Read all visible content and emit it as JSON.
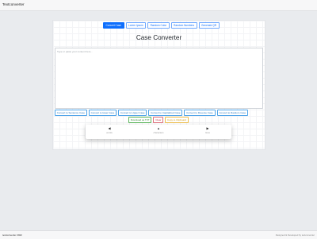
{
  "app": {
    "brand": "Textconverter"
  },
  "tabs": [
    {
      "label": "Convert Case",
      "active": true
    },
    {
      "label": "Lorem Ipsum"
    },
    {
      "label": "Random Color"
    },
    {
      "label": "Random Numbers"
    },
    {
      "label": "Generate QR"
    }
  ],
  "main": {
    "title": "Case Converter",
    "editor_placeholder": "Type or paste your content here..."
  },
  "convert_buttons": [
    "Convert to Sentence Case",
    "Convert to lower Case",
    "Convert to Upper Case",
    "Convert to Capitalized Case",
    "Convert to Reverse Case",
    "Convert to Random Case"
  ],
  "action_buttons": {
    "download": "Download as TXT",
    "clear": "Clear",
    "copy": "Copy to Clipboard"
  },
  "pager": {
    "previous": {
      "arrow": "◀",
      "label": "words"
    },
    "middle": {
      "arrow": "▲",
      "label": "characters"
    },
    "next": {
      "arrow": "▶",
      "label": "lines"
    }
  },
  "footer": {
    "left": "textconverter 2022",
    "right": "Designed & Developed by textconverter"
  },
  "colors": {
    "primary": "#0d6efd",
    "success": "#5cb85c",
    "danger": "#dc3545",
    "warning": "#f0ad4e"
  }
}
